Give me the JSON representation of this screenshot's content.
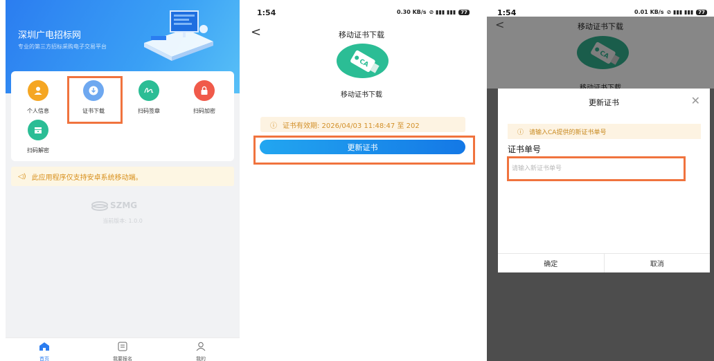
{
  "panel1": {
    "hero_title": "深圳广电招标网",
    "hero_subtitle": "专业的第三方招标采购电子交易平台",
    "functions": [
      {
        "label": "个人信息",
        "icon": "user-icon",
        "color": "#f5a623"
      },
      {
        "label": "证书下载",
        "icon": "download-icon",
        "color": "#3b8ff0"
      },
      {
        "label": "扫码签章",
        "icon": "signature-icon",
        "color": "#2bbd95"
      },
      {
        "label": "扫码加密",
        "icon": "lock-icon",
        "color": "#f05a4a"
      },
      {
        "label": "扫码解密",
        "icon": "unlock-icon",
        "color": "#2bbd95"
      }
    ],
    "notice": "此应用程序仅支持安卓系统移动端。",
    "logo_text": "SZMG",
    "version": "当前版本: 1.0.0",
    "tabs": [
      {
        "label": "首页",
        "icon": "home-icon"
      },
      {
        "label": "我要报名",
        "icon": "list-icon"
      },
      {
        "label": "我的",
        "icon": "profile-icon"
      }
    ]
  },
  "panel2": {
    "time": "1:54",
    "speed": "0.30 KB/s",
    "battery": "77",
    "nav_title": "移动证书下载",
    "caption": "移动证书下载",
    "validity": "证书有效期: 2026/04/03 11:48:47 至 202",
    "update_button": "更新证书",
    "usb_text": "CA"
  },
  "panel3": {
    "time": "1:54",
    "speed": "0.01 KB/s",
    "battery": "77",
    "nav_title": "移动证书下载",
    "caption": "移动证书下载",
    "usb_text": "CA",
    "dialog": {
      "title": "更新证书",
      "tip": "请输入CA提供的新证书单号",
      "field_label": "证书单号",
      "placeholder": "请输入新证书单号",
      "confirm": "确定",
      "cancel": "取消"
    }
  }
}
